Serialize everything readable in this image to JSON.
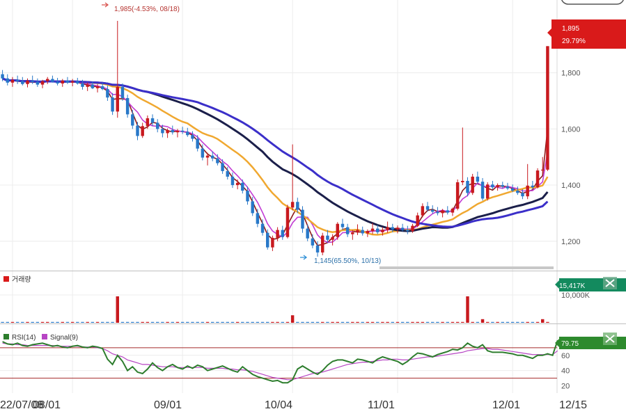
{
  "chart_data": [
    {
      "type": "candlestick",
      "panel": "price",
      "x_ticks": [
        "22/07/08",
        "08/01",
        "09/01",
        "10/04",
        "11/01",
        "12/01",
        "12/15"
      ],
      "y_ticks": [
        "1,800",
        "1,600",
        "1,400",
        "1,200"
      ],
      "ylim": [
        1130,
        1990
      ],
      "grid": true,
      "last_price_tag": {
        "price": "1,895",
        "change": "29.79%",
        "color": "#d91a1a"
      },
      "annotations": {
        "high": "1,985(-4.53%, 08/18)",
        "low": "1,145(65.50%, 10/13)"
      },
      "candles": [
        [
          1795,
          1810,
          1770,
          1780
        ],
        [
          1780,
          1795,
          1755,
          1765
        ],
        [
          1765,
          1785,
          1750,
          1775
        ],
        [
          1775,
          1790,
          1760,
          1770
        ],
        [
          1770,
          1785,
          1755,
          1760
        ],
        [
          1760,
          1780,
          1748,
          1772
        ],
        [
          1772,
          1790,
          1760,
          1768
        ],
        [
          1768,
          1780,
          1750,
          1758
        ],
        [
          1758,
          1775,
          1745,
          1770
        ],
        [
          1770,
          1785,
          1760,
          1778
        ],
        [
          1778,
          1790,
          1765,
          1768
        ],
        [
          1768,
          1782,
          1755,
          1762
        ],
        [
          1762,
          1778,
          1750,
          1772
        ],
        [
          1772,
          1785,
          1760,
          1765
        ],
        [
          1765,
          1778,
          1752,
          1770
        ],
        [
          1770,
          1782,
          1758,
          1762
        ],
        [
          1762,
          1775,
          1740,
          1750
        ],
        [
          1750,
          1765,
          1735,
          1758
        ],
        [
          1758,
          1770,
          1742,
          1745
        ],
        [
          1745,
          1760,
          1730,
          1752
        ],
        [
          1752,
          1765,
          1738,
          1742
        ],
        [
          1742,
          1755,
          1700,
          1712
        ],
        [
          1712,
          1728,
          1650,
          1662
        ],
        [
          1662,
          1985,
          1640,
          1750
        ],
        [
          1750,
          1762,
          1700,
          1710
        ],
        [
          1710,
          1722,
          1640,
          1652
        ],
        [
          1652,
          1668,
          1600,
          1612
        ],
        [
          1612,
          1625,
          1560,
          1575
        ],
        [
          1575,
          1622,
          1568,
          1610
        ],
        [
          1610,
          1648,
          1600,
          1638
        ],
        [
          1638,
          1652,
          1610,
          1622
        ],
        [
          1622,
          1635,
          1588,
          1600
        ],
        [
          1600,
          1615,
          1570,
          1585
        ],
        [
          1585,
          1602,
          1568,
          1596
        ],
        [
          1596,
          1612,
          1580,
          1588
        ],
        [
          1588,
          1600,
          1570,
          1594
        ],
        [
          1594,
          1608,
          1582,
          1590
        ],
        [
          1590,
          1604,
          1572,
          1578
        ],
        [
          1578,
          1592,
          1555,
          1565
        ],
        [
          1565,
          1578,
          1520,
          1530
        ],
        [
          1530,
          1545,
          1488,
          1498
        ],
        [
          1498,
          1515,
          1470,
          1505
        ],
        [
          1505,
          1520,
          1485,
          1495
        ],
        [
          1495,
          1510,
          1470,
          1478
        ],
        [
          1478,
          1492,
          1440,
          1450
        ],
        [
          1450,
          1465,
          1420,
          1430
        ],
        [
          1430,
          1445,
          1390,
          1400
        ],
        [
          1400,
          1420,
          1385,
          1408
        ],
        [
          1408,
          1420,
          1370,
          1380
        ],
        [
          1380,
          1395,
          1330,
          1342
        ],
        [
          1342,
          1358,
          1290,
          1300
        ],
        [
          1300,
          1315,
          1250,
          1262
        ],
        [
          1262,
          1278,
          1220,
          1230
        ],
        [
          1230,
          1242,
          1170,
          1178
        ],
        [
          1178,
          1220,
          1165,
          1212
        ],
        [
          1212,
          1250,
          1200,
          1240
        ],
        [
          1240,
          1255,
          1205,
          1215
        ],
        [
          1215,
          1330,
          1210,
          1320
        ],
        [
          1320,
          1545,
          1310,
          1340
        ],
        [
          1340,
          1355,
          1300,
          1312
        ],
        [
          1312,
          1325,
          1230,
          1245
        ],
        [
          1245,
          1260,
          1200,
          1210
        ],
        [
          1210,
          1225,
          1175,
          1185
        ],
        [
          1185,
          1200,
          1145,
          1160
        ],
        [
          1160,
          1230,
          1150,
          1220
        ],
        [
          1220,
          1240,
          1195,
          1205
        ],
        [
          1205,
          1225,
          1185,
          1215
        ],
        [
          1215,
          1268,
          1205,
          1262
        ],
        [
          1262,
          1280,
          1240,
          1250
        ],
        [
          1250,
          1262,
          1215,
          1225
        ],
        [
          1225,
          1240,
          1205,
          1232
        ],
        [
          1232,
          1260,
          1222,
          1240
        ],
        [
          1240,
          1252,
          1220,
          1228
        ],
        [
          1228,
          1242,
          1215,
          1236
        ],
        [
          1236,
          1265,
          1225,
          1245
        ],
        [
          1245,
          1258,
          1225,
          1232
        ],
        [
          1232,
          1250,
          1220,
          1240
        ],
        [
          1240,
          1270,
          1230,
          1250
        ],
        [
          1250,
          1262,
          1232,
          1242
        ],
        [
          1242,
          1256,
          1228,
          1248
        ],
        [
          1248,
          1262,
          1235,
          1240
        ],
        [
          1240,
          1255,
          1225,
          1236
        ],
        [
          1236,
          1262,
          1230,
          1255
        ],
        [
          1255,
          1302,
          1250,
          1292
        ],
        [
          1292,
          1335,
          1285,
          1325
        ],
        [
          1325,
          1340,
          1305,
          1312
        ],
        [
          1312,
          1328,
          1298,
          1305
        ],
        [
          1305,
          1322,
          1292,
          1300
        ],
        [
          1300,
          1315,
          1285,
          1310
        ],
        [
          1310,
          1325,
          1295,
          1302
        ],
        [
          1302,
          1320,
          1290,
          1316
        ],
        [
          1316,
          1420,
          1310,
          1410
        ],
        [
          1410,
          1605,
          1400,
          1415
        ],
        [
          1415,
          1428,
          1360,
          1372
        ],
        [
          1372,
          1440,
          1365,
          1430
        ],
        [
          1430,
          1448,
          1405,
          1412
        ],
        [
          1412,
          1425,
          1345,
          1352
        ],
        [
          1352,
          1410,
          1345,
          1402
        ],
        [
          1402,
          1415,
          1385,
          1392
        ],
        [
          1392,
          1406,
          1380,
          1400
        ],
        [
          1400,
          1412,
          1388,
          1395
        ],
        [
          1395,
          1408,
          1382,
          1388
        ],
        [
          1388,
          1402,
          1375,
          1380
        ],
        [
          1380,
          1395,
          1365,
          1372
        ],
        [
          1372,
          1385,
          1350,
          1360
        ],
        [
          1360,
          1475,
          1350,
          1398
        ],
        [
          1398,
          1415,
          1385,
          1392
        ],
        [
          1392,
          1460,
          1388,
          1452
        ],
        [
          1452,
          1500,
          1440,
          1455
        ],
        [
          1455,
          1895,
          1450,
          1895
        ]
      ],
      "ma": [
        {
          "color": "#8b1a1a",
          "period": 3
        },
        {
          "color": "#c23bd4",
          "period": 5
        },
        {
          "color": "#f0a830",
          "period": 15
        },
        {
          "color": "#1b1f4a",
          "period": 30
        },
        {
          "color": "#3b2fc9",
          "period": 40
        }
      ]
    },
    {
      "type": "bar",
      "panel": "volume",
      "legend": "거래량",
      "y_ticks": [
        "10,000K"
      ],
      "last_value_tag": {
        "value": "15,417K",
        "color": "#138a5e"
      },
      "spikes": [
        {
          "index": 23,
          "value": 9500
        },
        {
          "index": 58,
          "value": 2700
        },
        {
          "index": 93,
          "value": 9500
        },
        {
          "index": 96,
          "value": 1300
        },
        {
          "index": 108,
          "value": 1300
        },
        {
          "index": 110,
          "value": 800
        },
        {
          "index": 111,
          "value": 15417
        }
      ],
      "base_value": 300,
      "ylim": [
        0,
        16000
      ]
    },
    {
      "type": "line",
      "panel": "rsi",
      "series": [
        {
          "name": "RSI(14)",
          "color": "#2d7d2d"
        },
        {
          "name": "Signal(9)",
          "color": "#b745c4"
        }
      ],
      "y_ticks": [
        "60",
        "40",
        "20"
      ],
      "ylim": [
        15,
        90
      ],
      "levels": [
        70,
        30
      ],
      "last_value_tag": {
        "value": "79.75",
        "color": "#2d8a2d"
      },
      "rsi_values": [
        78,
        75,
        74,
        76,
        73,
        72,
        74,
        75,
        76,
        74,
        72,
        73,
        71,
        70,
        72,
        73,
        71,
        70,
        72,
        71,
        69,
        55,
        48,
        60,
        52,
        40,
        45,
        38,
        36,
        42,
        50,
        44,
        40,
        45,
        48,
        44,
        42,
        46,
        43,
        47,
        45,
        40,
        42,
        44,
        46,
        43,
        40,
        38,
        45,
        40,
        35,
        32,
        30,
        28,
        26,
        27,
        24,
        24,
        28,
        42,
        46,
        42,
        38,
        35,
        40,
        47,
        52,
        54,
        54,
        52,
        50,
        55,
        54,
        52,
        50,
        55,
        58,
        56,
        54,
        52,
        48,
        52,
        58,
        63,
        62,
        60,
        58,
        61,
        63,
        65,
        68,
        67,
        70,
        76,
        72,
        70,
        74,
        66,
        64,
        64,
        64,
        63,
        62,
        60,
        60,
        58,
        56,
        60,
        60,
        62,
        60,
        79.75
      ],
      "signal_values": [
        76,
        75,
        75,
        74,
        74,
        73,
        73,
        73,
        73,
        73,
        73,
        72,
        72,
        72,
        72,
        72,
        71,
        71,
        71,
        70,
        69,
        66,
        62,
        60,
        58,
        54,
        52,
        50,
        48,
        48,
        47,
        46,
        45,
        45,
        45,
        44,
        44,
        44,
        44,
        44,
        44,
        43,
        43,
        43,
        43,
        42,
        42,
        41,
        41,
        40,
        39,
        37,
        35,
        33,
        31,
        30,
        29,
        28,
        28,
        30,
        32,
        34,
        36,
        37,
        38,
        40,
        42,
        44,
        46,
        48,
        49,
        50,
        51,
        51,
        52,
        53,
        54,
        54,
        55,
        55,
        54,
        54,
        55,
        56,
        57,
        58,
        58,
        59,
        60,
        61,
        62,
        63,
        64,
        66,
        67,
        68,
        69,
        69,
        68,
        68,
        67,
        66,
        65,
        64,
        63,
        62,
        61,
        61,
        61,
        61,
        61,
        66
      ]
    }
  ]
}
